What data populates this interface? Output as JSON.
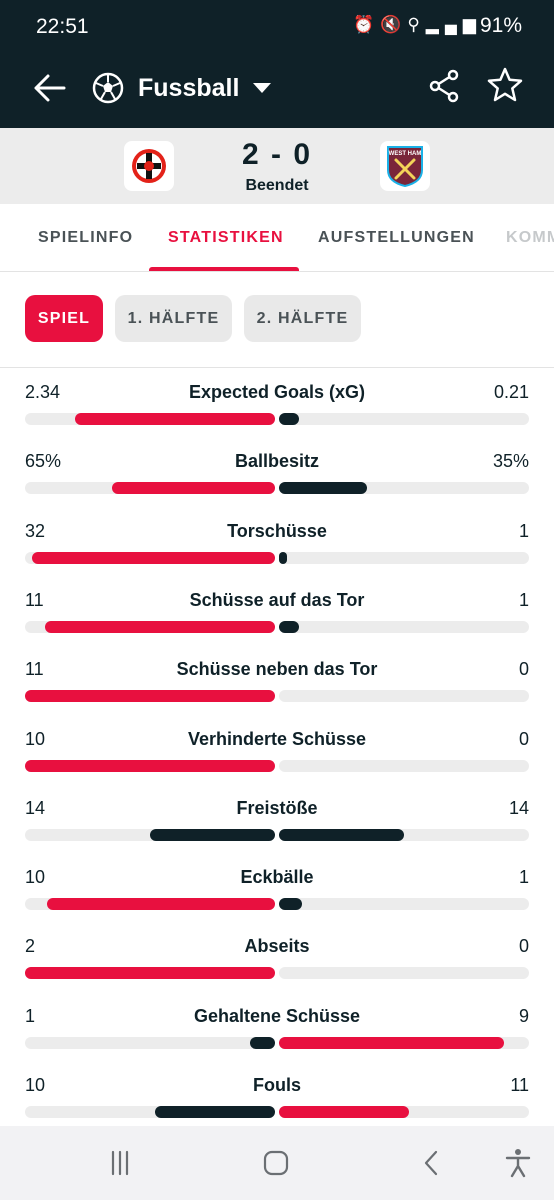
{
  "status_bar": {
    "time": "22:51",
    "icons": [
      "alarm-icon",
      "mute-icon",
      "wifi-icon",
      "volte-icon",
      "signal-icon"
    ],
    "battery": "91%"
  },
  "app_bar": {
    "sport": "Fussball",
    "icons": [
      "back-arrow-icon",
      "football-icon",
      "share-icon",
      "star-icon"
    ]
  },
  "match": {
    "score": "2 - 0",
    "status": "Beendet",
    "home_crest": "bayer-leverkusen-crest",
    "away_crest": "west-ham-crest",
    "away_crest_text": "WEST HAM"
  },
  "tabs": [
    {
      "label": "SPIELINFO",
      "active": false
    },
    {
      "label": "STATISTIKEN",
      "active": true
    },
    {
      "label": "AUFSTELLUNGEN",
      "active": false
    },
    {
      "label": "KOMM",
      "active": false
    }
  ],
  "periods": [
    {
      "label": "SPIEL",
      "active": true
    },
    {
      "label": "1. HÄLFTE",
      "active": false
    },
    {
      "label": "2. HÄLFTE",
      "active": false
    }
  ],
  "colors": {
    "home": "#e8103f",
    "away": "#0f2128",
    "dark": "#0f2128",
    "track": "#ececec"
  },
  "stats": [
    {
      "label": "Expected Goals (xG)",
      "home": "2.34",
      "away": "0.21",
      "home_share": 0.8,
      "away_share": 0.08,
      "home_color": "home",
      "away_color": "away"
    },
    {
      "label": "Ballbesitz",
      "home": "65%",
      "away": "35%",
      "home_share": 0.65,
      "away_share": 0.35,
      "home_color": "home",
      "away_color": "away"
    },
    {
      "label": "Torschüsse",
      "home": "32",
      "away": "1",
      "home_share": 0.97,
      "away_share": 0.03,
      "home_color": "home",
      "away_color": "away"
    },
    {
      "label": "Schüsse auf das Tor",
      "home": "11",
      "away": "1",
      "home_share": 0.92,
      "away_share": 0.08,
      "home_color": "home",
      "away_color": "away"
    },
    {
      "label": "Schüsse neben das Tor",
      "home": "11",
      "away": "0",
      "home_share": 1.0,
      "away_share": 0.0,
      "home_color": "home",
      "away_color": "away"
    },
    {
      "label": "Verhinderte Schüsse",
      "home": "10",
      "away": "0",
      "home_share": 1.0,
      "away_share": 0.0,
      "home_color": "home",
      "away_color": "away"
    },
    {
      "label": "Freistöße",
      "home": "14",
      "away": "14",
      "home_share": 0.5,
      "away_share": 0.5,
      "home_color": "away",
      "away_color": "away"
    },
    {
      "label": "Eckbälle",
      "home": "10",
      "away": "1",
      "home_share": 0.91,
      "away_share": 0.09,
      "home_color": "home",
      "away_color": "away"
    },
    {
      "label": "Abseits",
      "home": "2",
      "away": "0",
      "home_share": 1.0,
      "away_share": 0.0,
      "home_color": "home",
      "away_color": "away"
    },
    {
      "label": "Gehaltene Schüsse",
      "home": "1",
      "away": "9",
      "home_share": 0.1,
      "away_share": 0.9,
      "home_color": "away",
      "away_color": "home"
    },
    {
      "label": "Fouls",
      "home": "10",
      "away": "11",
      "home_share": 0.48,
      "away_share": 0.52,
      "home_color": "away",
      "away_color": "home"
    }
  ],
  "nav_bar": {
    "icons": [
      "recent-apps-icon",
      "home-icon",
      "back-icon",
      "accessibility-icon"
    ]
  }
}
